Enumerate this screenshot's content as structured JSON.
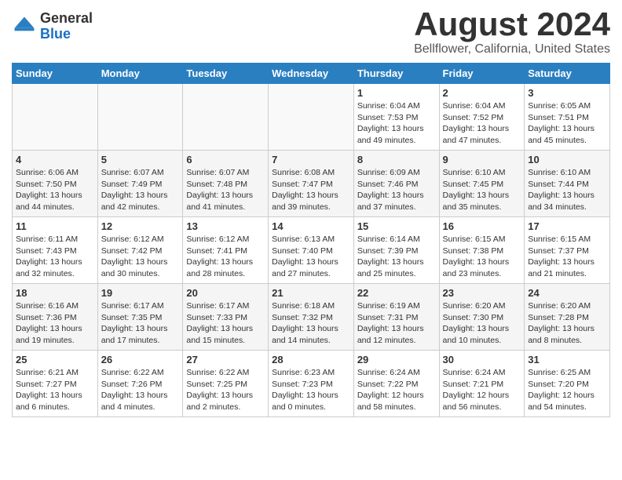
{
  "header": {
    "logo_general": "General",
    "logo_blue": "Blue",
    "title": "August 2024",
    "subtitle": "Bellflower, California, United States"
  },
  "days_of_week": [
    "Sunday",
    "Monday",
    "Tuesday",
    "Wednesday",
    "Thursday",
    "Friday",
    "Saturday"
  ],
  "weeks": [
    [
      {
        "day": "",
        "sunrise": "",
        "sunset": "",
        "daylight": ""
      },
      {
        "day": "",
        "sunrise": "",
        "sunset": "",
        "daylight": ""
      },
      {
        "day": "",
        "sunrise": "",
        "sunset": "",
        "daylight": ""
      },
      {
        "day": "",
        "sunrise": "",
        "sunset": "",
        "daylight": ""
      },
      {
        "day": "1",
        "sunrise": "6:04 AM",
        "sunset": "7:53 PM",
        "daylight": "13 hours and 49 minutes."
      },
      {
        "day": "2",
        "sunrise": "6:04 AM",
        "sunset": "7:52 PM",
        "daylight": "13 hours and 47 minutes."
      },
      {
        "day": "3",
        "sunrise": "6:05 AM",
        "sunset": "7:51 PM",
        "daylight": "13 hours and 45 minutes."
      }
    ],
    [
      {
        "day": "4",
        "sunrise": "6:06 AM",
        "sunset": "7:50 PM",
        "daylight": "13 hours and 44 minutes."
      },
      {
        "day": "5",
        "sunrise": "6:07 AM",
        "sunset": "7:49 PM",
        "daylight": "13 hours and 42 minutes."
      },
      {
        "day": "6",
        "sunrise": "6:07 AM",
        "sunset": "7:48 PM",
        "daylight": "13 hours and 41 minutes."
      },
      {
        "day": "7",
        "sunrise": "6:08 AM",
        "sunset": "7:47 PM",
        "daylight": "13 hours and 39 minutes."
      },
      {
        "day": "8",
        "sunrise": "6:09 AM",
        "sunset": "7:46 PM",
        "daylight": "13 hours and 37 minutes."
      },
      {
        "day": "9",
        "sunrise": "6:10 AM",
        "sunset": "7:45 PM",
        "daylight": "13 hours and 35 minutes."
      },
      {
        "day": "10",
        "sunrise": "6:10 AM",
        "sunset": "7:44 PM",
        "daylight": "13 hours and 34 minutes."
      }
    ],
    [
      {
        "day": "11",
        "sunrise": "6:11 AM",
        "sunset": "7:43 PM",
        "daylight": "13 hours and 32 minutes."
      },
      {
        "day": "12",
        "sunrise": "6:12 AM",
        "sunset": "7:42 PM",
        "daylight": "13 hours and 30 minutes."
      },
      {
        "day": "13",
        "sunrise": "6:12 AM",
        "sunset": "7:41 PM",
        "daylight": "13 hours and 28 minutes."
      },
      {
        "day": "14",
        "sunrise": "6:13 AM",
        "sunset": "7:40 PM",
        "daylight": "13 hours and 27 minutes."
      },
      {
        "day": "15",
        "sunrise": "6:14 AM",
        "sunset": "7:39 PM",
        "daylight": "13 hours and 25 minutes."
      },
      {
        "day": "16",
        "sunrise": "6:15 AM",
        "sunset": "7:38 PM",
        "daylight": "13 hours and 23 minutes."
      },
      {
        "day": "17",
        "sunrise": "6:15 AM",
        "sunset": "7:37 PM",
        "daylight": "13 hours and 21 minutes."
      }
    ],
    [
      {
        "day": "18",
        "sunrise": "6:16 AM",
        "sunset": "7:36 PM",
        "daylight": "13 hours and 19 minutes."
      },
      {
        "day": "19",
        "sunrise": "6:17 AM",
        "sunset": "7:35 PM",
        "daylight": "13 hours and 17 minutes."
      },
      {
        "day": "20",
        "sunrise": "6:17 AM",
        "sunset": "7:33 PM",
        "daylight": "13 hours and 15 minutes."
      },
      {
        "day": "21",
        "sunrise": "6:18 AM",
        "sunset": "7:32 PM",
        "daylight": "13 hours and 14 minutes."
      },
      {
        "day": "22",
        "sunrise": "6:19 AM",
        "sunset": "7:31 PM",
        "daylight": "13 hours and 12 minutes."
      },
      {
        "day": "23",
        "sunrise": "6:20 AM",
        "sunset": "7:30 PM",
        "daylight": "13 hours and 10 minutes."
      },
      {
        "day": "24",
        "sunrise": "6:20 AM",
        "sunset": "7:28 PM",
        "daylight": "13 hours and 8 minutes."
      }
    ],
    [
      {
        "day": "25",
        "sunrise": "6:21 AM",
        "sunset": "7:27 PM",
        "daylight": "13 hours and 6 minutes."
      },
      {
        "day": "26",
        "sunrise": "6:22 AM",
        "sunset": "7:26 PM",
        "daylight": "13 hours and 4 minutes."
      },
      {
        "day": "27",
        "sunrise": "6:22 AM",
        "sunset": "7:25 PM",
        "daylight": "13 hours and 2 minutes."
      },
      {
        "day": "28",
        "sunrise": "6:23 AM",
        "sunset": "7:23 PM",
        "daylight": "13 hours and 0 minutes."
      },
      {
        "day": "29",
        "sunrise": "6:24 AM",
        "sunset": "7:22 PM",
        "daylight": "12 hours and 58 minutes."
      },
      {
        "day": "30",
        "sunrise": "6:24 AM",
        "sunset": "7:21 PM",
        "daylight": "12 hours and 56 minutes."
      },
      {
        "day": "31",
        "sunrise": "6:25 AM",
        "sunset": "7:20 PM",
        "daylight": "12 hours and 54 minutes."
      }
    ]
  ],
  "labels": {
    "sunrise_prefix": "Sunrise: ",
    "sunset_prefix": "Sunset: ",
    "daylight_prefix": "Daylight: "
  }
}
